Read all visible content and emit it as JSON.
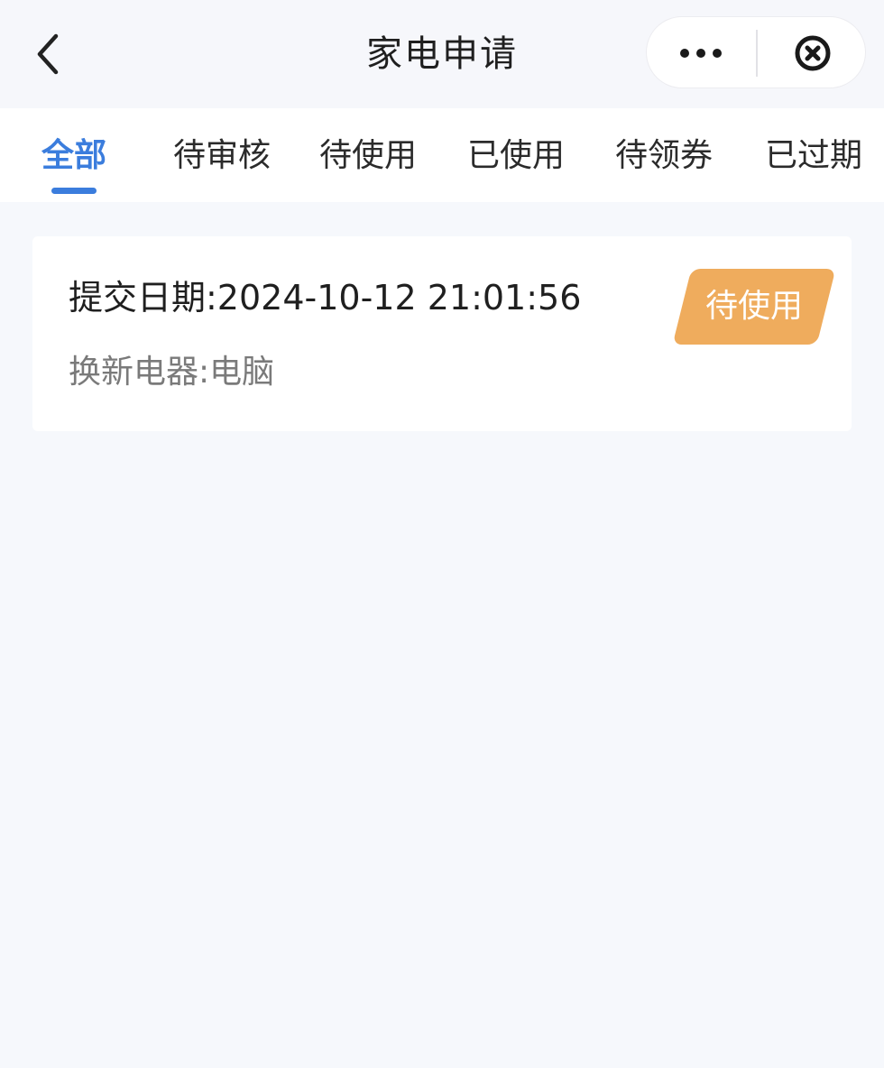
{
  "header": {
    "title": "家电申请",
    "back_icon": "chevron-left-icon",
    "more_icon": "more-dots-icon",
    "close_icon": "close-circle-icon"
  },
  "tabs": [
    {
      "label": "全部",
      "active": true
    },
    {
      "label": "待审核",
      "active": false
    },
    {
      "label": "待使用",
      "active": false
    },
    {
      "label": "已使用",
      "active": false
    },
    {
      "label": "待领券",
      "active": false
    },
    {
      "label": "已过期",
      "active": false
    }
  ],
  "records": [
    {
      "submit_date": "提交日期:2024-10-12 21:01:56",
      "appliance": "换新电器:电脑",
      "status": "待使用"
    }
  ],
  "colors": {
    "accent": "#3b7ddd",
    "status_badge": "#efac5d",
    "background": "#f6f8fc"
  }
}
